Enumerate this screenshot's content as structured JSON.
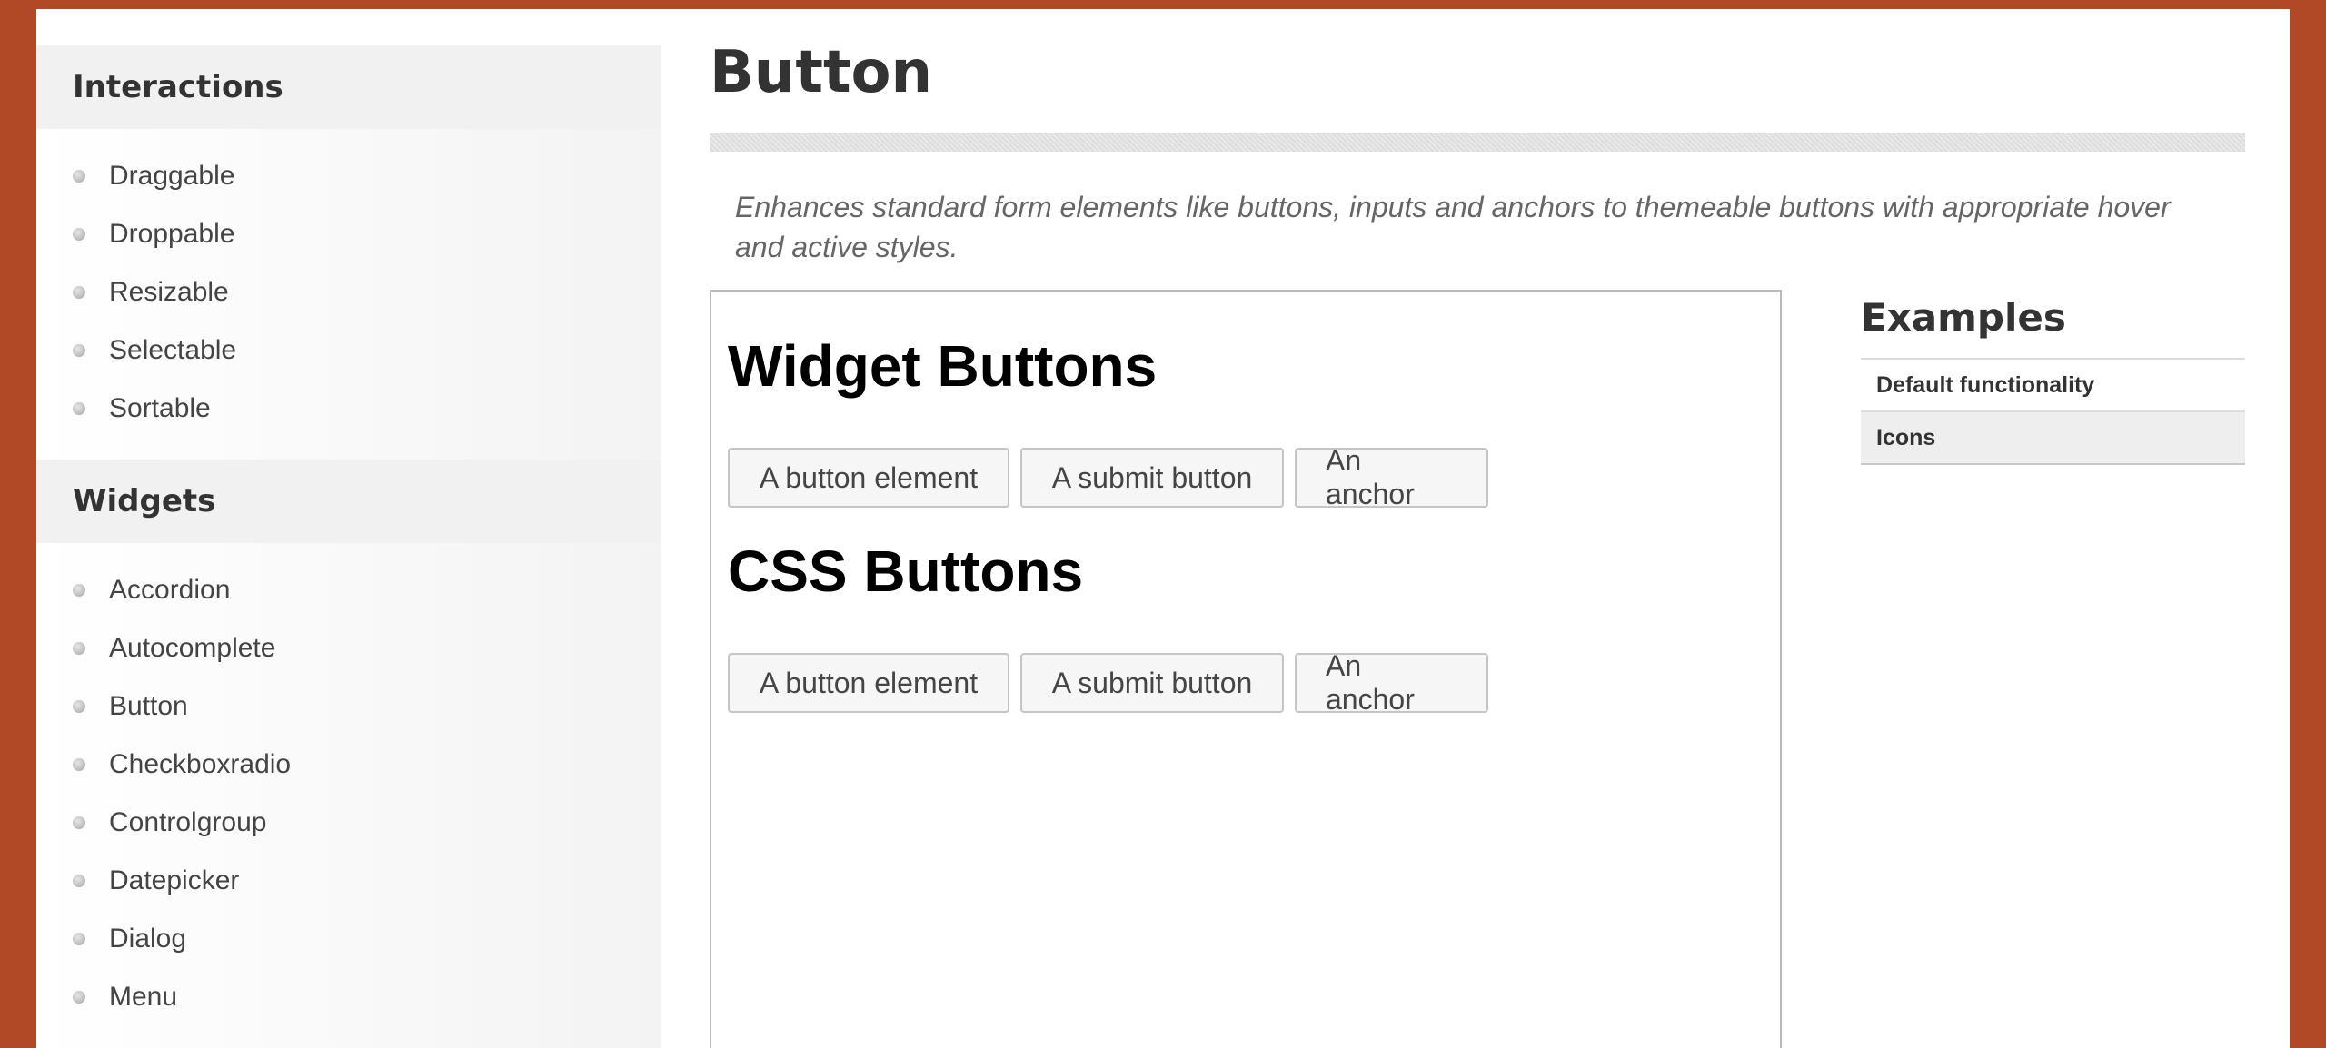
{
  "sidebar": {
    "interactions": {
      "title": "Interactions",
      "items": [
        "Draggable",
        "Droppable",
        "Resizable",
        "Selectable",
        "Sortable"
      ]
    },
    "widgets": {
      "title": "Widgets",
      "items": [
        "Accordion",
        "Autocomplete",
        "Button",
        "Checkboxradio",
        "Controlgroup",
        "Datepicker",
        "Dialog",
        "Menu"
      ]
    }
  },
  "main": {
    "title": "Button",
    "description": "Enhances standard form elements like buttons, inputs and anchors to themeable buttons with appropriate hover and active styles.",
    "demo": {
      "widget_heading": "Widget Buttons",
      "widget_buttons": [
        "A button element",
        "A submit button",
        "An anchor"
      ],
      "css_heading": "CSS Buttons",
      "css_buttons": [
        "A button element",
        "A submit button",
        "An anchor"
      ]
    },
    "examples": {
      "title": "Examples",
      "items": [
        "Default functionality",
        "Icons"
      ],
      "active_index": 1
    }
  },
  "colors": {
    "frame_background": "#b24926",
    "text_dark": "#333333",
    "text_muted": "#666666",
    "button_background": "#f6f6f6",
    "button_border": "#c5c5c5"
  },
  "icons": {
    "sidebar_bullet": "bullet-dot-icon"
  }
}
